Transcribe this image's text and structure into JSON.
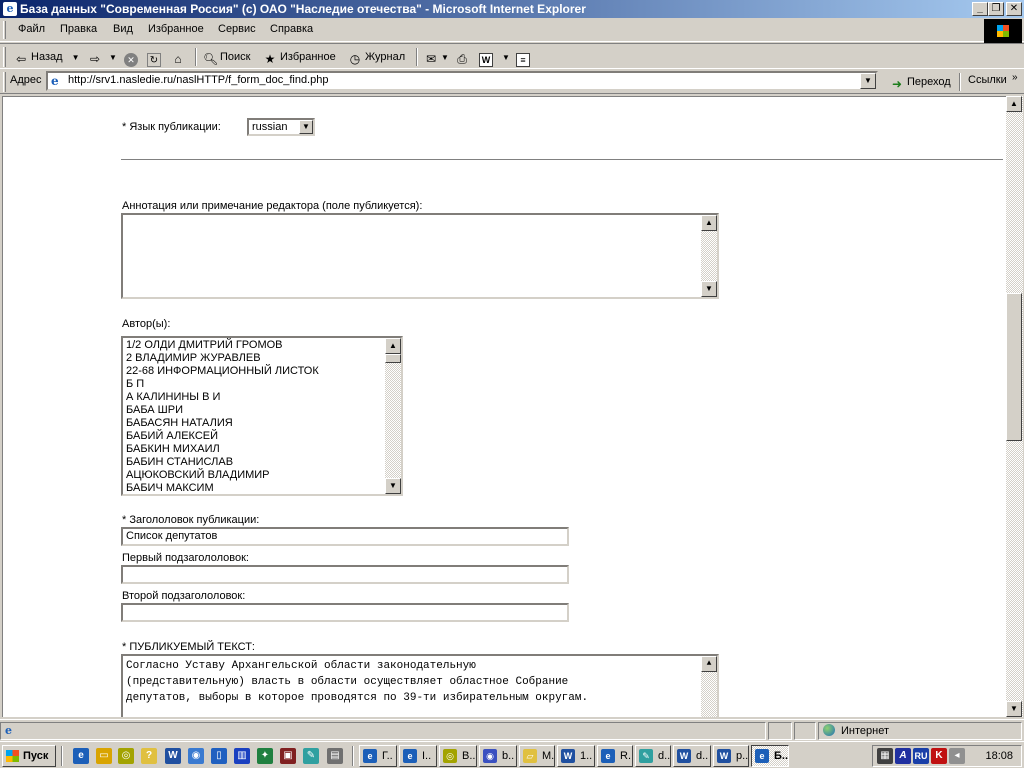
{
  "window": {
    "title": "База данных \"Современная Россия\" (c) ОАО \"Наследие отечества\" - Microsoft Internet Explorer"
  },
  "menu": [
    "Файл",
    "Правка",
    "Вид",
    "Избранное",
    "Сервис",
    "Справка"
  ],
  "toolbar": {
    "back": "Назад",
    "search": "Поиск",
    "favorites": "Избранное",
    "history": "Журнал"
  },
  "address": {
    "label": "Адрес",
    "url": "http://srv1.nasledie.ru/naslHTTP/f_form_doc_find.php",
    "go": "Переход",
    "links": "Ссылки"
  },
  "form": {
    "language_label": "* Язык публикации:",
    "language_value": "russian",
    "annotation_label": "Аннотация или примечание редактора (поле публикуется):",
    "annotation_value": "",
    "authors_label": "Автор(ы):",
    "authors": [
      "1/2 ОЛДИ ДМИТРИЙ ГРОМОВ",
      "2 ВЛАДИМИР ЖУРАВЛЕВ",
      "22-68 ИНФОРМАЦИОННЫЙ ЛИСТОК",
      "Б П",
      "А КАЛИНИНЫ В И",
      "БАБА ШРИ",
      "БАБАСЯН НАТАЛИЯ",
      "БАБИЙ АЛЕКСЕЙ",
      "БАБКИН МИХАИЛ",
      "БАБИН СТАНИСЛАВ",
      "АЦЮКОВСКИЙ ВЛАДИМИР",
      "БАБИЧ МАКСИМ"
    ],
    "title_label": "* Загололовок публикации:",
    "title_value": "Список депутатов",
    "subtitle1_label": "Первый подзагололовок:",
    "subtitle1_value": "",
    "subtitle2_label": "Второй подзагололовок:",
    "subtitle2_value": "",
    "text_label": "* ПУБЛИКУЕМЫЙ ТЕКСТ:",
    "text_lines": [
      "Согласно Уставу Архангельской области законодательную",
      "(представительную) власть в области осуществляет областное Собрание",
      "депутатов, выборы в которое проводятся по 39-ти избирательным округам."
    ]
  },
  "status": {
    "zone": "Интернет"
  },
  "taskbar": {
    "start": "Пуск",
    "tasks": [
      "Г..",
      "I..",
      "В..",
      "b..",
      "М..",
      "1..",
      "R..",
      "d..",
      "d..",
      "р..",
      "Б.."
    ],
    "language": "RU",
    "clock": "18:08"
  }
}
